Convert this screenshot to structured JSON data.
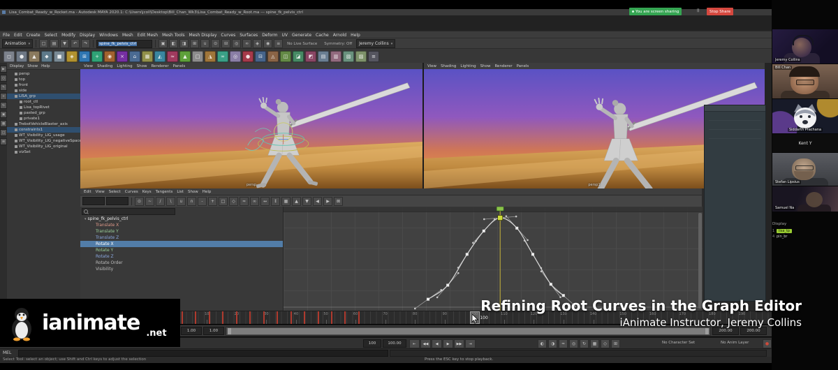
{
  "colors": {
    "accent_green": "#8bc34a",
    "key_yellow": "#cddc39",
    "timeline_key_red": "#b03a2e",
    "current_time": "#c9b43a",
    "curve": "#d8d8d8",
    "selection_blue": "#527da8"
  },
  "titlebar": {
    "title": "Lisa_Combat_Ready_w_Rocket.ma - Autodesk MAYA 2020.1: C:\\Users\\jcoll\\Desktop\\Bill_Chan_Wk3\\Lisa_Combat_Ready_w_Root.ma --- spine_fk_pelvis_ctrl"
  },
  "zoom": {
    "recording_badge": "You are screen sharing",
    "pause_icon": "||",
    "stop_share": "Stop Share"
  },
  "menubar": [
    "File",
    "Edit",
    "Create",
    "Select",
    "Modify",
    "Display",
    "Windows",
    "Mesh",
    "Edit Mesh",
    "Mesh Tools",
    "Mesh Display",
    "Curves",
    "Surfaces",
    "Deform",
    "UV",
    "Generate",
    "Cache",
    "Arnold",
    "Help"
  ],
  "statusline": {
    "menuset": "Animation",
    "scene_name_field": "spine_fk_pelvis_ctrl",
    "no_live": "No Live Surface",
    "symmetry": "Symmetry: Off",
    "workspace": "Jeremy Collins"
  },
  "statusline_icons_a": [
    {
      "n": "new-scene-icon",
      "g": "□"
    },
    {
      "n": "open-scene-icon",
      "g": "▤"
    },
    {
      "n": "save-scene-icon",
      "g": "▼"
    },
    {
      "n": "undo-icon",
      "g": "↶"
    },
    {
      "n": "redo-icon",
      "g": "↷"
    }
  ],
  "statusline_icons_b": [
    {
      "n": "select-hierarchy-icon",
      "g": "▣"
    },
    {
      "n": "select-object-icon",
      "g": "◧"
    },
    {
      "n": "select-component-icon",
      "g": "◨"
    },
    {
      "n": "snap-grid-icon",
      "g": "⊞"
    },
    {
      "n": "snap-curve-icon",
      "g": "∪"
    },
    {
      "n": "snap-point-icon",
      "g": "⊙"
    },
    {
      "n": "snap-plane-icon",
      "g": "⊟"
    },
    {
      "n": "make-live-icon",
      "g": "◎"
    },
    {
      "n": "construction-history-icon",
      "g": "∞"
    },
    {
      "n": "render-icon",
      "g": "◈"
    },
    {
      "n": "ipr-render-icon",
      "g": "◉"
    },
    {
      "n": "render-settings-icon",
      "g": "≡"
    }
  ],
  "shelf_icons": [
    {
      "c": "#7d828c",
      "g": "◻"
    },
    {
      "c": "#6e7885",
      "g": "●"
    },
    {
      "c": "#8a7a5e",
      "g": "▲"
    },
    {
      "c": "#5e7a8a",
      "g": "◆"
    },
    {
      "c": "#7a8a95",
      "g": "■"
    },
    {
      "c": "#b2922f",
      "g": "◈"
    },
    {
      "c": "#2f76b2",
      "g": "⊞"
    },
    {
      "c": "#2fa276",
      "g": "+"
    },
    {
      "c": "#a2622f",
      "g": "◉"
    },
    {
      "c": "#762fa2",
      "g": "×"
    },
    {
      "c": "#4a6a92",
      "g": "⌂"
    },
    {
      "c": "#92904a",
      "g": "▦"
    },
    {
      "c": "#3a86a0",
      "g": "◭"
    },
    {
      "c": "#a03a5e",
      "g": "≈"
    },
    {
      "c": "#5ea03a",
      "g": "▲"
    },
    {
      "c": "#8c8c8c",
      "g": "□"
    },
    {
      "c": "#a0763a",
      "g": "◮"
    },
    {
      "c": "#3aa086",
      "g": "∞"
    },
    {
      "c": "#8a7ea6",
      "g": "◎"
    },
    {
      "c": "#a63a4a",
      "g": "●"
    },
    {
      "c": "#46648a",
      "g": "⊟"
    },
    {
      "c": "#8a6446",
      "g": "◬"
    },
    {
      "c": "#648a46",
      "g": "◫"
    },
    {
      "c": "#468a64",
      "g": "◪"
    },
    {
      "c": "#8a4664",
      "g": "◩"
    },
    {
      "c": "#6a7e92",
      "g": "▤"
    },
    {
      "c": "#926a7e",
      "g": "▥"
    },
    {
      "c": "#6a927e",
      "g": "▧"
    },
    {
      "c": "#7e926a",
      "g": "▨"
    },
    {
      "c": "#55555f",
      "g": "≡"
    }
  ],
  "toolbox_icons": [
    {
      "n": "select-tool-icon",
      "g": "▶"
    },
    {
      "n": "lasso-tool-icon",
      "g": "○"
    },
    {
      "n": "paint-select-tool-icon",
      "g": "✎"
    },
    {
      "n": "move-tool-icon",
      "g": "+"
    },
    {
      "n": "rotate-tool-icon",
      "g": "↻"
    },
    {
      "n": "scale-tool-icon",
      "g": "▣"
    },
    {
      "n": "last-tool-icon",
      "g": "▦"
    },
    {
      "n": "layout-single-pane-icon",
      "g": "□"
    },
    {
      "n": "layout-four-pane-icon",
      "g": "⊞"
    }
  ],
  "outliner": {
    "menus": [
      "Display",
      "Show",
      "Help"
    ],
    "items": [
      {
        "label": "persp",
        "indent": 1
      },
      {
        "label": "top",
        "indent": 1
      },
      {
        "label": "front",
        "indent": 1
      },
      {
        "label": "side",
        "indent": 1
      },
      {
        "label": "LISA_grp",
        "indent": 1,
        "selected": true
      },
      {
        "label": "root_ctl",
        "indent": 2
      },
      {
        "label": "Lisa_topRivet",
        "indent": 2
      },
      {
        "label": "pasted_grp",
        "indent": 2
      },
      {
        "label": "private1",
        "indent": 2
      },
      {
        "label": "TrebotVehicleBlaster_axis",
        "indent": 1
      },
      {
        "label": "constraints1",
        "indent": 1,
        "selected": true
      },
      {
        "label": "WT_Visibility_LIG_usage",
        "indent": 1
      },
      {
        "label": "WT_Visibility_LIG_negativeSpace",
        "indent": 1
      },
      {
        "label": "WT_Visibility_LIG_original",
        "indent": 1
      },
      {
        "label": "vizSet",
        "indent": 1
      }
    ]
  },
  "viewport": {
    "menus": [
      "View",
      "Shading",
      "Lighting",
      "Show",
      "Renderer",
      "Panels"
    ],
    "cameras": [
      "persp",
      "persp1"
    ]
  },
  "graph_editor": {
    "menus": [
      "Edit",
      "View",
      "Select",
      "Curves",
      "Keys",
      "Tangents",
      "List",
      "Show",
      "Help"
    ],
    "stats": [
      "",
      ""
    ],
    "toolbar_icons": [
      "⊙",
      "~",
      "/",
      "\\",
      "∪",
      "∩",
      "-",
      "+",
      "□",
      "◇",
      "≈",
      "∞",
      "↔",
      "↕",
      "▦",
      "▲",
      "▼",
      "◀",
      "▶",
      "⊠"
    ],
    "root": "spine_fk_pelvis_ctrl",
    "channels": [
      {
        "label": "Translate X",
        "color": "#e09a8a"
      },
      {
        "label": "Translate Y",
        "color": "#9ad09a"
      },
      {
        "label": "Translate Z",
        "color": "#8aa8e0"
      },
      {
        "label": "Rotate X",
        "color": "#ffffff",
        "selected": true
      },
      {
        "label": "Rotate Y",
        "color": "#9ad09a"
      },
      {
        "label": "Rotate Z",
        "color": "#8aa8e0"
      },
      {
        "label": "Rotate Order",
        "color": "#bdbdbd"
      },
      {
        "label": "Visibility",
        "color": "#bdbdbd"
      }
    ],
    "curve": {
      "keys": [
        {
          "t": 0.345,
          "v": 0.93
        },
        {
          "t": 0.392,
          "v": 0.78
        },
        {
          "t": 0.438,
          "v": 0.45
        },
        {
          "t": 0.478,
          "v": 0.2
        },
        {
          "t": 0.517,
          "v": 0.06
        },
        {
          "t": 0.557,
          "v": 0.17
        },
        {
          "t": 0.595,
          "v": 0.45
        },
        {
          "t": 0.638,
          "v": 0.77
        },
        {
          "t": 0.668,
          "v": 0.89
        }
      ],
      "selected_index": 4,
      "current_t": 0.517
    }
  },
  "timeline": {
    "start": 1,
    "end": 200,
    "label_step": 10,
    "current": "100",
    "key_ticks": [
      0.002,
      0.025,
      0.048,
      0.071,
      0.094,
      0.117,
      0.14,
      0.163,
      0.186,
      0.209,
      0.232,
      0.255,
      0.278,
      0.301
    ]
  },
  "range": {
    "anim_start": "1.00",
    "play_start": "1.00",
    "play_end": "200.00",
    "anim_end": "200.00"
  },
  "playback": {
    "frame_field": "100",
    "frame_field2": "100.00",
    "char_set": "No Character Set",
    "anim_layer": "No Anim Layer"
  },
  "transport": [
    {
      "n": "go-to-start-button",
      "g": "⇤"
    },
    {
      "n": "step-back-key-button",
      "g": "◀◀"
    },
    {
      "n": "step-back-button",
      "g": "◀"
    },
    {
      "n": "play-forward-button",
      "g": "▶"
    },
    {
      "n": "step-forward-button",
      "g": "▶▶"
    },
    {
      "n": "go-to-end-button",
      "g": "⇥"
    }
  ],
  "ctrl_icons": [
    "◐",
    "◑",
    "≈",
    "◎",
    "↻",
    "▦",
    "◇",
    "⊞"
  ],
  "command_line": {
    "label": "MEL"
  },
  "help_line": {
    "text": "Select Tool: select an object; use Shift and Ctrl keys to adjust the selection",
    "hint": "Press the ESC key to stop playback."
  },
  "participants": [
    {
      "name": "Jeremy Collins"
    },
    {
      "name": "Bill Chan"
    },
    {
      "name": "Siddarth Prachana"
    },
    {
      "name": "Kent Y"
    },
    {
      "name": "Stefan Lipsius"
    },
    {
      "name": "Samuel Na"
    }
  ],
  "side_panel": {
    "tab": "Display",
    "gutter": [
      "1",
      "4"
    ],
    "rows": [
      {
        "label": "lisa_tp",
        "highlight": true
      },
      {
        "label": "pin_br",
        "highlight": false
      }
    ]
  },
  "overlay": {
    "title": "Refining Root Curves in the Graph Editor",
    "subtitle": "iAnimate Instructor, Jeremy Collins"
  },
  "logo": {
    "brand": "ianimate",
    "tld": ".net"
  }
}
